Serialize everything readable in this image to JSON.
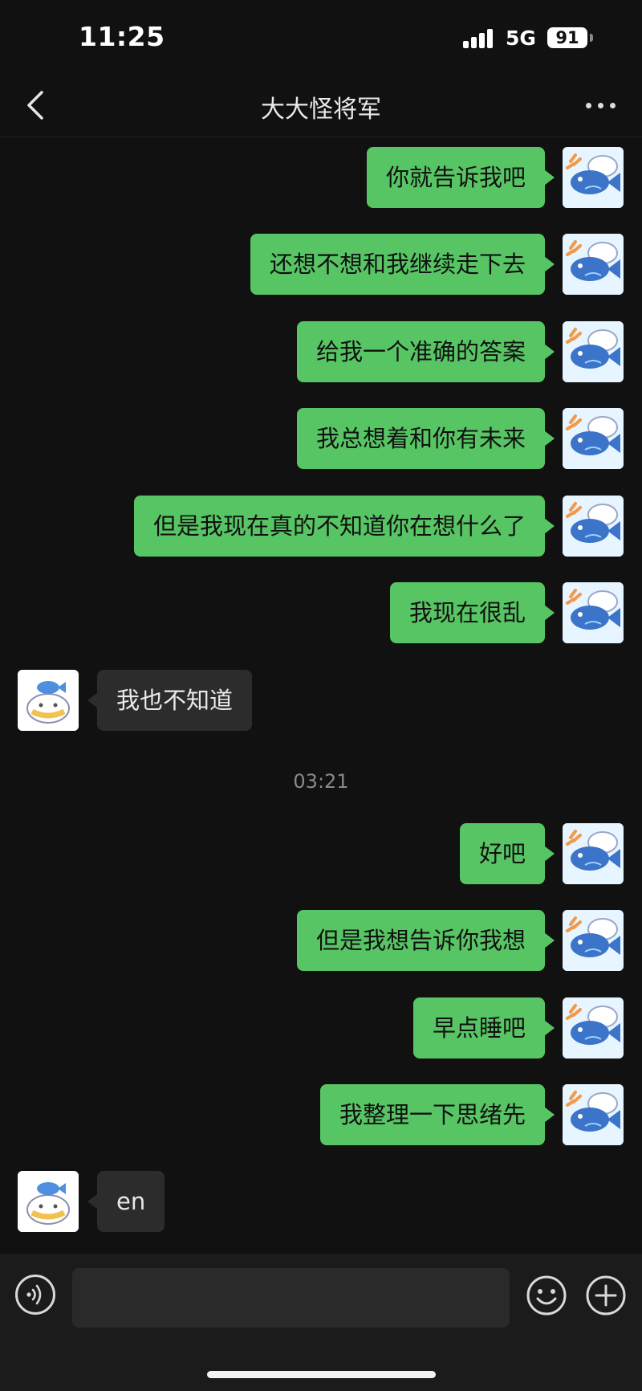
{
  "status_bar": {
    "time": "11:25",
    "network": "5G",
    "battery": "91"
  },
  "header": {
    "title": "大大怪将军"
  },
  "messages": [
    {
      "direction": "out",
      "text": "你就告诉我吧"
    },
    {
      "direction": "out",
      "text": "还想不想和我继续走下去"
    },
    {
      "direction": "out",
      "text": "给我一个准确的答案"
    },
    {
      "direction": "out",
      "text": "我总想着和你有未来"
    },
    {
      "direction": "out",
      "text": "但是我现在真的不知道你在想什么了"
    },
    {
      "direction": "out",
      "text": "我现在很乱"
    },
    {
      "direction": "in",
      "text": "我也不知道"
    },
    {
      "direction": "out",
      "text": "好吧"
    },
    {
      "direction": "out",
      "text": "但是我想告诉你我想"
    },
    {
      "direction": "out",
      "text": "早点睡吧"
    },
    {
      "direction": "out",
      "text": "我整理一下思绪先"
    },
    {
      "direction": "in",
      "text": "en"
    }
  ],
  "timestamp": "03:21",
  "input_bar": {
    "placeholder": "",
    "icons": [
      "voice-icon",
      "emoji-icon",
      "plus-icon"
    ]
  },
  "colors": {
    "sent_bubble": "#57c564",
    "received_bubble": "#2c2c2c",
    "background": "#111111"
  }
}
